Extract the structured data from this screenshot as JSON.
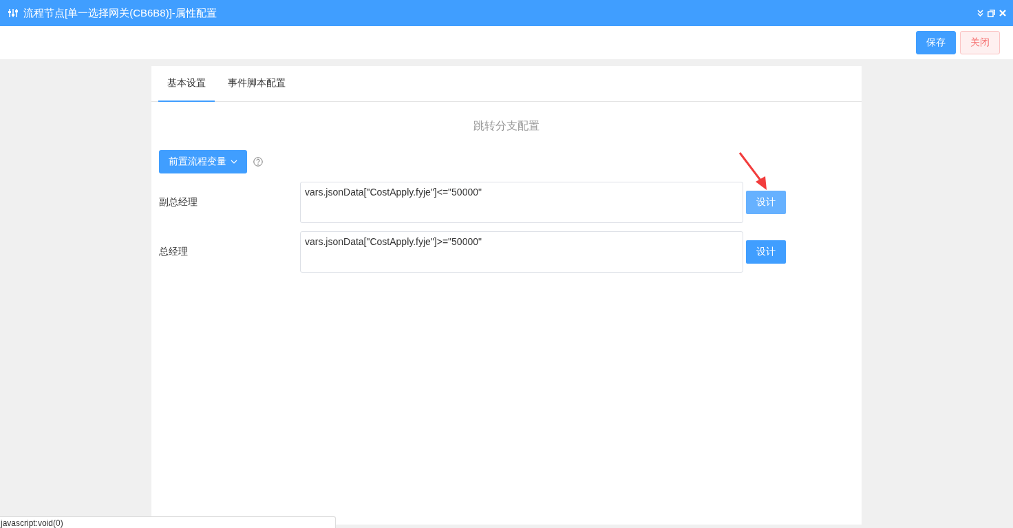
{
  "window": {
    "title": "流程节点[单一选择网关(CB6B8)]-属性配置"
  },
  "toolbar": {
    "buttons": [
      {
        "label": "保存",
        "kind": "primary"
      },
      {
        "label": "关闭",
        "kind": "danger"
      }
    ]
  },
  "tabs": [
    {
      "label": "基本设置",
      "selected": true
    },
    {
      "label": "事件脚本配置",
      "selected": false
    }
  ],
  "section_title": "跳转分支配置",
  "variables_button": {
    "label": "前置流程变量"
  },
  "branches": [
    {
      "label": "副总经理",
      "condition": "vars.jsonData[\"CostApply.fyje\"]<=\"50000\"",
      "button": "设计",
      "hovered": true
    },
    {
      "label": "总经理",
      "condition": "vars.jsonData[\"CostApply.fyje\"]>=\"50000\"",
      "button": "设计",
      "hovered": false
    }
  ],
  "status_bar": {
    "text": "javascript:void(0)"
  }
}
